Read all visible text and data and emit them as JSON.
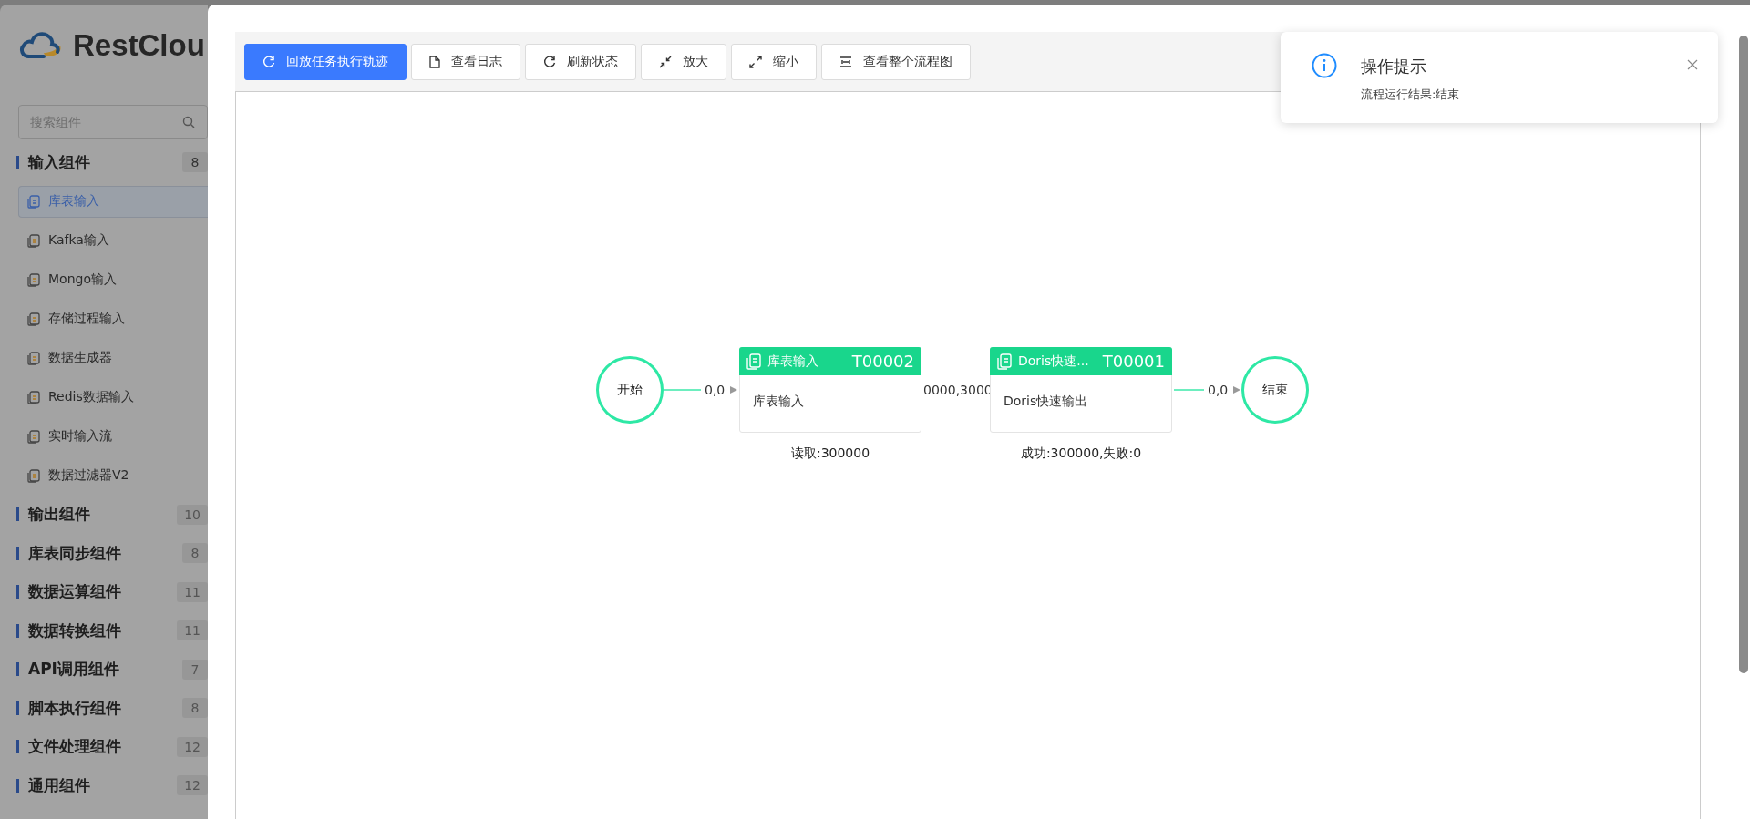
{
  "sidebar": {
    "logo": "RestClou",
    "search": {
      "placeholder": "搜索组件"
    },
    "groups": [
      {
        "label": "输入组件",
        "count": "8",
        "expanded": true,
        "children": [
          {
            "label": "库表输入",
            "selected": true
          },
          {
            "label": "Kafka输入",
            "selected": false
          },
          {
            "label": "Mongo输入",
            "selected": false
          },
          {
            "label": "存储过程输入",
            "selected": false
          },
          {
            "label": "数据生成器",
            "selected": false
          },
          {
            "label": "Redis数据输入",
            "selected": false
          },
          {
            "label": "实时输入流",
            "selected": false
          },
          {
            "label": "数据过滤器V2",
            "selected": false
          }
        ]
      },
      {
        "label": "输出组件",
        "count": "10",
        "expanded": false
      },
      {
        "label": "库表同步组件",
        "count": "8",
        "expanded": false
      },
      {
        "label": "数据运算组件",
        "count": "11",
        "expanded": false
      },
      {
        "label": "数据转换组件",
        "count": "11",
        "expanded": false
      },
      {
        "label": "API调用组件",
        "count": "7",
        "expanded": false
      },
      {
        "label": "脚本执行组件",
        "count": "8",
        "expanded": false
      },
      {
        "label": "文件处理组件",
        "count": "12",
        "expanded": false
      },
      {
        "label": "通用组件",
        "count": "12",
        "expanded": false
      }
    ]
  },
  "toolbar": {
    "buttons": [
      {
        "label": "回放任务执行轨迹",
        "primary": true
      },
      {
        "label": "查看日志",
        "primary": false
      },
      {
        "label": "刷新状态",
        "primary": false
      },
      {
        "label": "放大",
        "primary": false
      },
      {
        "label": "缩小",
        "primary": false
      },
      {
        "label": "查看整个流程图",
        "primary": false
      }
    ]
  },
  "diagram": {
    "nodes": [
      {
        "kind": "circle",
        "label": "开始"
      },
      {
        "kind": "task",
        "title": "库表输入",
        "code": "T00002",
        "body": "库表输入",
        "stats": "读取:300000"
      },
      {
        "kind": "task",
        "title": "Doris快速...",
        "code": "T00001",
        "body": "Doris快速输出",
        "stats": "成功:300000,失败:0"
      },
      {
        "kind": "circle",
        "label": "结束"
      }
    ],
    "edge_labels": [
      "0,0",
      "0000,3000",
      "0,0"
    ]
  },
  "notification": {
    "title": "操作提示",
    "message": "流程运行结果:结束"
  }
}
